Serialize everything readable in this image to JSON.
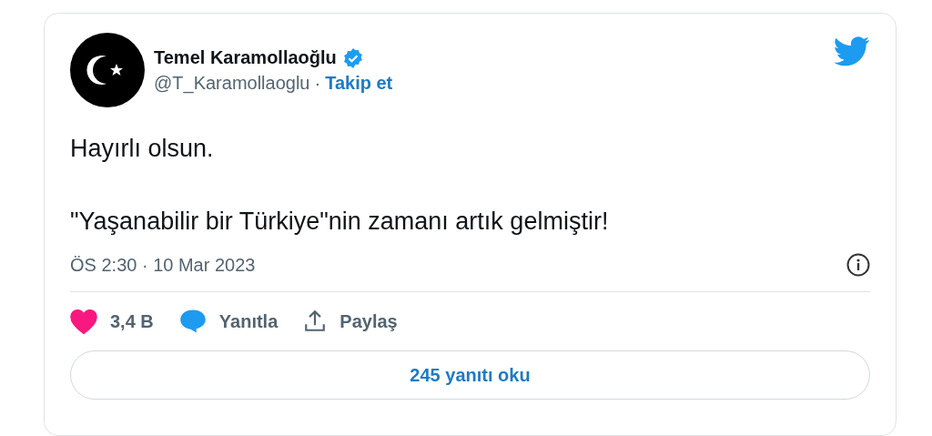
{
  "author": {
    "name": "Temel Karamollaoğlu",
    "verified": true,
    "handle": "@T_Karamollaoglu",
    "separator": "·",
    "follow": "Takip et"
  },
  "tweet": {
    "paragraphs": [
      "Hayırlı olsun.",
      "\"Yaşanabilir bir Türkiye\"nin zamanı artık gelmiştir!"
    ],
    "timestamp": "ÖS 2:30 · 10 Mar 2023"
  },
  "actions": [
    {
      "kind": "like",
      "label": "3,4 B",
      "liked": true
    },
    {
      "kind": "reply",
      "label": "Yanıtla"
    },
    {
      "kind": "share",
      "label": "Paylaş"
    }
  ],
  "read_replies": "245 yanıtı oku"
}
